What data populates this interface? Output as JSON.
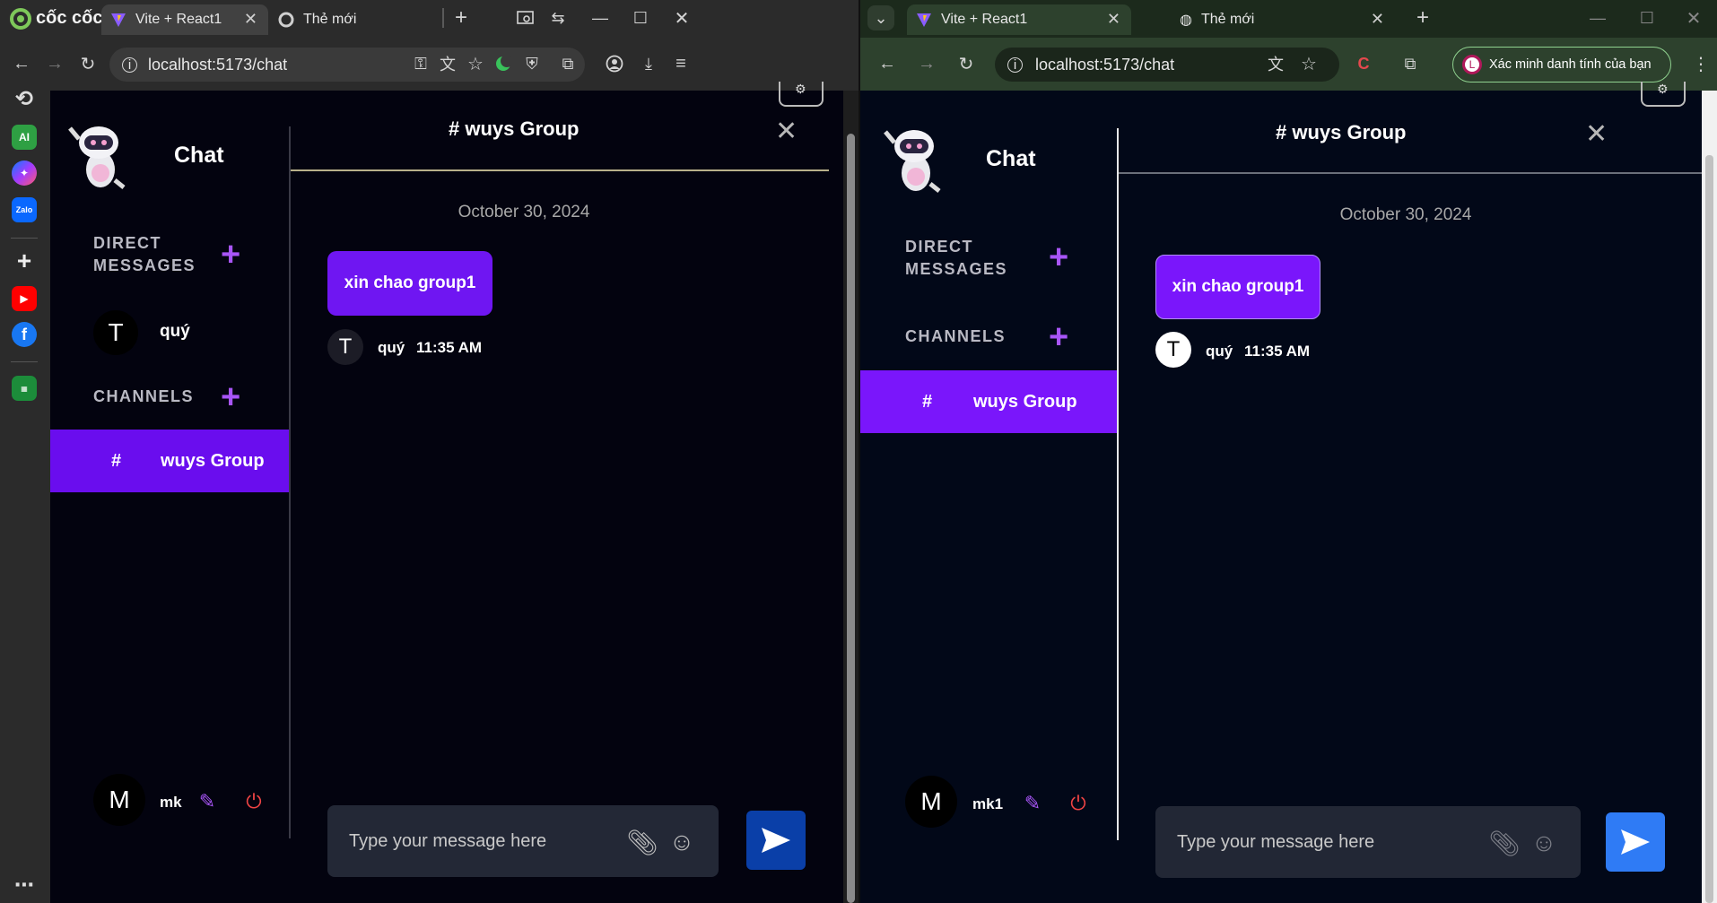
{
  "left": {
    "brand": "cốc cốc",
    "tabs": [
      {
        "label": "Vite + React1"
      },
      {
        "label": "Thẻ mới"
      }
    ],
    "address": "localhost:5173/chat",
    "sidebar": {
      "title": "Chat",
      "direct_messages_label": "DIRECT\nMESSAGES",
      "channels_label": "CHANNELS",
      "contacts": [
        {
          "initial": "T",
          "name": "quý"
        }
      ],
      "channels": [
        {
          "hash": "#",
          "name": "wuys Group"
        }
      ],
      "user": {
        "initial": "M",
        "name": "mk"
      }
    },
    "chat": {
      "group_title": "# wuys Group",
      "date": "October 30, 2024",
      "messages": [
        {
          "text": "xin chao group1",
          "author_initial": "T",
          "author": "quý",
          "time": "11:35 AM"
        }
      ],
      "input_placeholder": "Type your message here"
    }
  },
  "right": {
    "tabs": [
      {
        "label": "Vite + React1"
      },
      {
        "label": "Thẻ mới"
      }
    ],
    "address": "localhost:5173/chat",
    "verify_label": "Xác minh danh tính của bạn",
    "profile_initial": "L",
    "sidebar": {
      "title": "Chat",
      "direct_messages_label": "DIRECT\nMESSAGES",
      "channels_label": "CHANNELS",
      "channels": [
        {
          "hash": "#",
          "name": "wuys Group"
        }
      ],
      "user": {
        "initial": "M",
        "name": "mk1"
      }
    },
    "chat": {
      "group_title": "# wuys Group",
      "date": "October 30, 2024",
      "messages": [
        {
          "text": "xin chao group1",
          "author_initial": "T",
          "author": "quý",
          "time": "11:35 AM"
        }
      ],
      "input_placeholder": "Type your message here"
    }
  },
  "rail": {
    "ai_label": "AI",
    "zalo_label": "Zalo"
  },
  "colors": {
    "accent": "#6a0dee",
    "plus": "#a855f7",
    "send_left": "#0a3fa8",
    "send_right": "#2f7bf5",
    "power": "#ef4444"
  }
}
